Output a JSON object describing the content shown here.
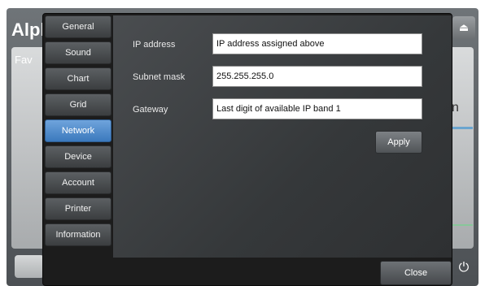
{
  "background": {
    "title_fragment": "Alph",
    "fav_fragment": "Fav",
    "right_letter": "n"
  },
  "dialog": {
    "tabs": [
      {
        "label": "General",
        "active": false
      },
      {
        "label": "Sound",
        "active": false
      },
      {
        "label": "Chart",
        "active": false
      },
      {
        "label": "Grid",
        "active": false
      },
      {
        "label": "Network",
        "active": true
      },
      {
        "label": "Device",
        "active": false
      },
      {
        "label": "Account",
        "active": false
      },
      {
        "label": "Printer",
        "active": false
      },
      {
        "label": "Information",
        "active": false
      }
    ],
    "fields": {
      "ip": {
        "label": "IP address",
        "value": "IP address assigned above"
      },
      "subnet": {
        "label": "Subnet mask",
        "value": "255.255.255.0"
      },
      "gateway": {
        "label": "Gateway",
        "value": "Last digit of available IP band 1"
      }
    },
    "apply_label": "Apply",
    "close_label": "Close"
  },
  "colors": {
    "active_tab": "#4a8ad0",
    "dialog_bg": "#1c1c1c"
  },
  "icons": {
    "top_right": "eject-icon",
    "bottom_right": "power-icon"
  }
}
